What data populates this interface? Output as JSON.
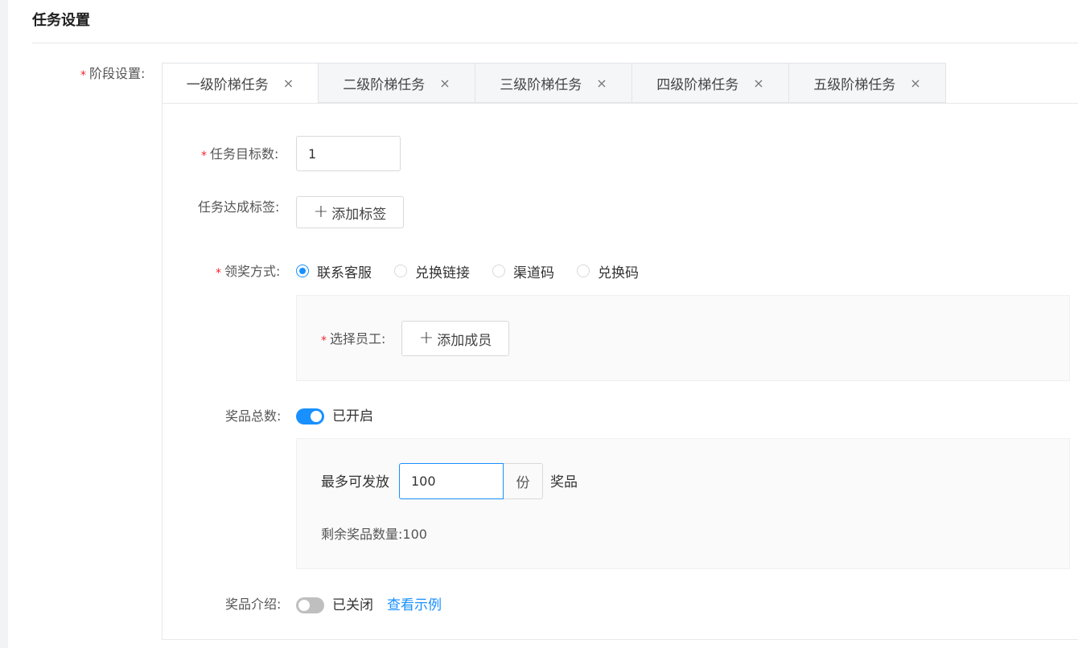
{
  "section": {
    "title": "任务设置"
  },
  "stage": {
    "label": "阶段设置:",
    "tabs": [
      {
        "label": "一级阶梯任务",
        "close": "×"
      },
      {
        "label": "二级阶梯任务",
        "close": "×"
      },
      {
        "label": "三级阶梯任务",
        "close": "×"
      },
      {
        "label": "四级阶梯任务",
        "close": "×"
      },
      {
        "label": "五级阶梯任务",
        "close": "×"
      }
    ],
    "active_tab": 0
  },
  "form": {
    "required_mark": "*",
    "target_count": {
      "label": "任务目标数:",
      "value": "1"
    },
    "achieve_tag": {
      "label": "任务达成标签:",
      "button_icon": "+",
      "button_label": "添加标签"
    },
    "reward_method": {
      "label": "领奖方式:",
      "options": [
        "联系客服",
        "兑换链接",
        "渠道码",
        "兑换码"
      ],
      "selected": 0
    },
    "select_staff": {
      "label": "选择员工:",
      "button_icon": "+",
      "button_label": "添加成员"
    },
    "prize_total": {
      "label": "奖品总数:",
      "switch_on": true,
      "status": "已开启",
      "max_label": "最多可发放",
      "max_value": "100",
      "unit": "份",
      "suffix": "奖品",
      "remaining_label": "剩余奖品数量:",
      "remaining_value": "100"
    },
    "prize_intro": {
      "label": "奖品介绍:",
      "switch_on": false,
      "status": "已关闭",
      "link": "查看示例"
    }
  },
  "colors": {
    "primary": "#1890ff",
    "required": "#f5222d"
  }
}
